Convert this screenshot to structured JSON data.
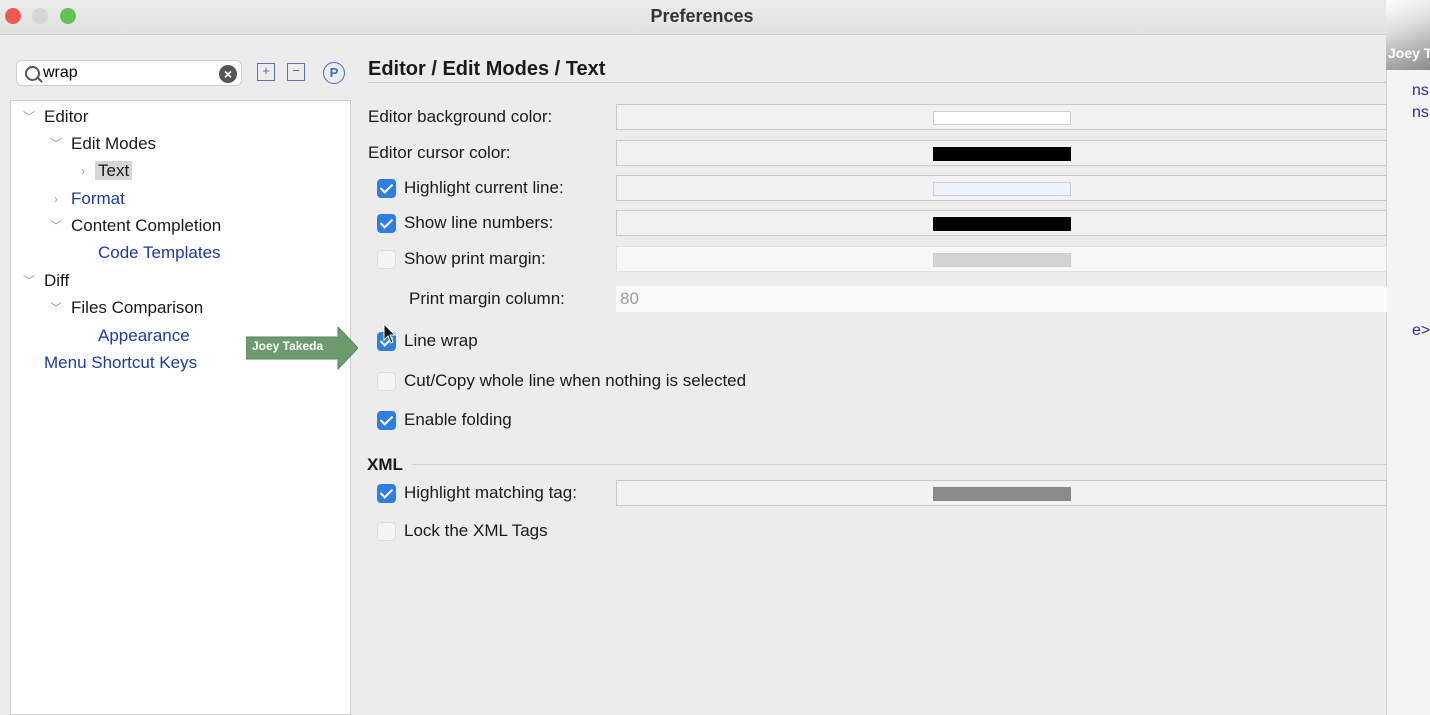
{
  "window": {
    "title": "Preferences"
  },
  "overlay": {
    "camera_label": "Joey T",
    "side_text": [
      "ns",
      "ns",
      "e>"
    ],
    "annotation_label": "Joey Takeda"
  },
  "search": {
    "value": "wrap"
  },
  "tree": {
    "editor": "Editor",
    "edit_modes": "Edit Modes",
    "text": "Text",
    "format": "Format",
    "content_completion": "Content Completion",
    "code_templates": "Code Templates",
    "diff": "Diff",
    "files_comparison": "Files Comparison",
    "appearance": "Appearance",
    "menu_shortcut_keys": "Menu Shortcut Keys"
  },
  "page": {
    "breadcrumb": "Editor / Edit Modes / Text",
    "rows": {
      "bg_color": {
        "label": "Editor background color:",
        "swatch": "#ffffff"
      },
      "cursor_color": {
        "label": "Editor cursor color:",
        "swatch": "#000000"
      },
      "highlight_line": {
        "label": "Highlight current line:",
        "checked": true,
        "swatch": "#eef3fb"
      },
      "line_numbers": {
        "label": "Show line numbers:",
        "checked": true,
        "swatch": "#000000"
      },
      "print_margin": {
        "label": "Show print margin:",
        "checked": false,
        "swatch": "#d4d4d4"
      },
      "print_margin_column": {
        "label": "Print margin column:",
        "value": "80"
      },
      "line_wrap": {
        "label": "Line wrap",
        "checked": true
      },
      "cut_copy": {
        "label": "Cut/Copy whole line when nothing is selected",
        "checked": false
      },
      "enable_folding": {
        "label": "Enable folding",
        "checked": true
      }
    },
    "xml": {
      "heading": "XML",
      "highlight_tag": {
        "label": "Highlight matching tag:",
        "checked": true,
        "swatch": "#8a8a8a"
      },
      "lock_tags": {
        "label": "Lock the XML Tags",
        "checked": false
      }
    }
  },
  "colors": {
    "accent": "#2f7fe0",
    "link": "#1c3aa8",
    "annotation": "#6e9a70"
  }
}
